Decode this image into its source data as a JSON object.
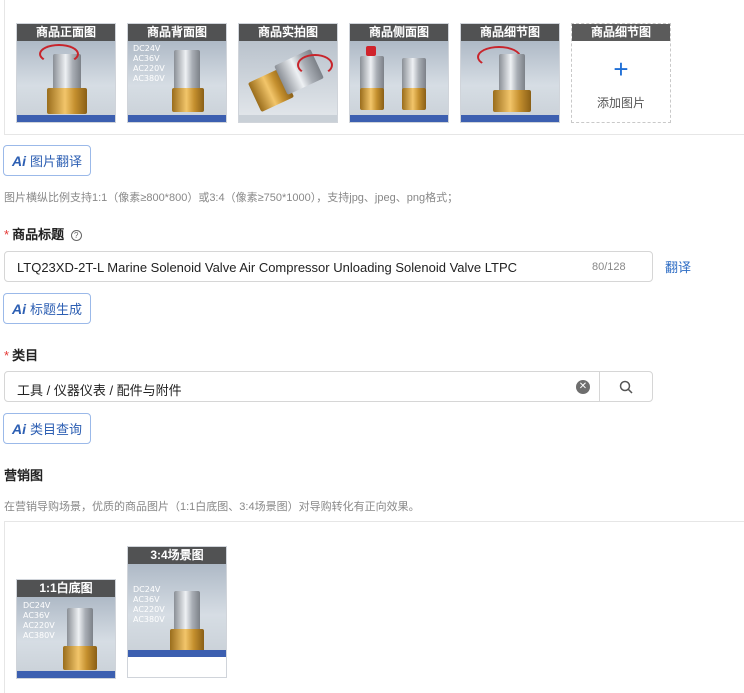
{
  "gallery": {
    "thumbs": [
      {
        "caption": "商品正面图"
      },
      {
        "caption": "商品背面图",
        "specs": [
          "DC24V",
          "AC36V",
          "AC220V",
          "AC380V"
        ]
      },
      {
        "caption": "商品实拍图"
      },
      {
        "caption": "商品侧面图"
      },
      {
        "caption": "商品细节图"
      }
    ],
    "add_slot": {
      "caption": "商品细节图",
      "icon": "plus-icon",
      "label": "添加图片"
    }
  },
  "image_translate_button": {
    "ai": "Ai",
    "label": "图片翻译"
  },
  "image_hint": "图片横纵比例支持1:1（像素≥800*800）或3:4（像素≥750*1000），支持jpg、jpeg、png格式；",
  "title_field": {
    "required_mark": "*",
    "label": "商品标题",
    "help_icon": "question-circle-icon",
    "value": "LTQ23XD-2T-L Marine Solenoid Valve Air Compressor Unloading Solenoid Valve LTPC",
    "counter": "80/128",
    "translate_link": "翻译"
  },
  "title_generate_button": {
    "ai": "Ai",
    "label": "标题生成"
  },
  "category_field": {
    "required_mark": "*",
    "label": "类目",
    "value": "工具 / 仪器仪表 / 配件与附件",
    "clear_icon": "clear-circle-icon",
    "search_icon": "search-icon"
  },
  "category_query_button": {
    "ai": "Ai",
    "label": "类目查询"
  },
  "marketing": {
    "label": "营销图",
    "hint": "在营销导购场景，优质的商品图片（1:1白底图、3:4场景图）对导购转化有正向效果。",
    "images": [
      {
        "caption": "1:1白底图",
        "specs": [
          "DC24V",
          "AC36V",
          "AC220V",
          "AC380V"
        ]
      },
      {
        "caption": "3:4场景图",
        "specs": [
          "DC24V",
          "AC36V",
          "AC220V",
          "AC380V"
        ]
      }
    ]
  },
  "colors": {
    "accent": "#2d6cc4",
    "required": "#e53935",
    "caption_bg": "#464646"
  }
}
